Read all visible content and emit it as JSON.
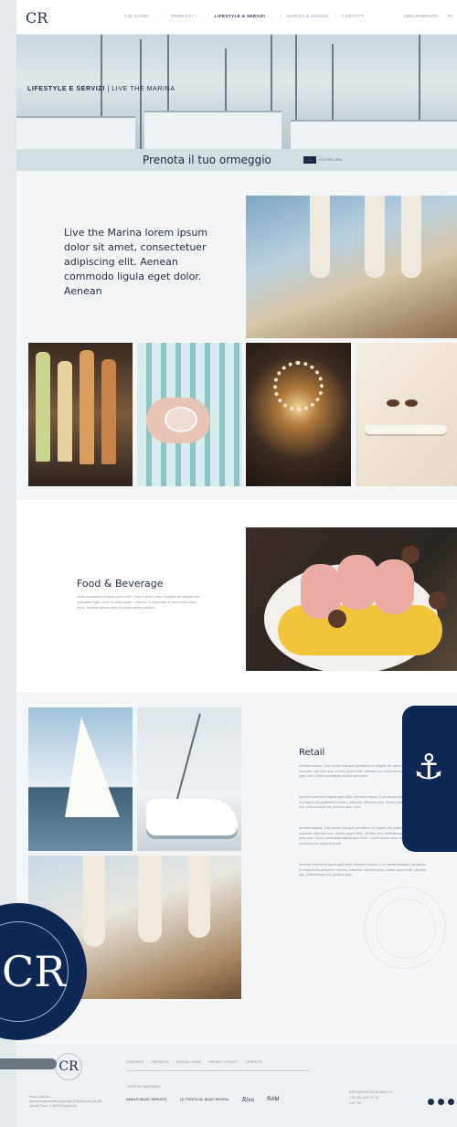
{
  "nav": {
    "logo": "CR",
    "menu": [
      {
        "label": "CHI SIAMO"
      },
      {
        "label": "ORMEGGI"
      },
      {
        "label": "LIFESTYLE & SERVIZI",
        "active": true
      },
      {
        "label": "MARINA & NEGOZI"
      },
      {
        "label": "CONTATTI"
      }
    ],
    "right": [
      "AREA RISERVATA",
      "ITA"
    ]
  },
  "hero": {
    "title_bold": "LIFESTYLE E SERVIZI",
    "title_rest": "| LIVE THE MARINA"
  },
  "booking": {
    "label": "Prenota il tuo ormeggio",
    "button_icon": "arrow-icon",
    "button_text": "SCOPRI ORA"
  },
  "section1": {
    "text": "Live the Marina lorem ipsum dolor sit amet, consectetuer adipiscing elit. Aenean commodo ligula eget dolor. Aenean"
  },
  "food": {
    "title": "Food & Beverage",
    "para": "Nulla consequat massa quis enim. Donec pede justo, fringilla vel aliquet nec, vulputate eget, arcu. In enim justo, rhoncus ut imperdiet a, venenatis vitae, justo. Nullam dictum felis eu pede mollis pretium."
  },
  "retail": {
    "title": "Retail",
    "paragraphs": [
      "Aenean massa. Cum sociis natoque penatibus et magnis dis parturient montes, nascetur ridiculus mus. Donec quam felis, ultricies nec, pellentesque eu, pretium quis, sem. Nulla consequat massa quis enim.",
      "Aenean commodo ligula eget dolor. Aenean massa. Cum sociis natoque penatibus et magnis dis parturient montes, nascetur ridiculus mus. Donec quam felis, ultricies nec, pellentesque eu, pretium quis, sem.",
      "Aenean massa. Cum sociis natoque penatibus et magnis dis parturient montes, nascetur ridiculus mus. Donec quam felis, ultricies nec, pellentesque eu, pretium quis, sem. Nulla consequat massa quis enim. Lorem ipsum dolor sit amet, consectetuer adipiscing elit.",
      "Aenean commodo ligula eget dolor. Aenean massa. Cum sociis natoque penatibus et magnis dis parturient montes, nascetur ridiculus mus. Donec quam felis, ultricies nec, pellentesque eu, pretium quis."
    ]
  },
  "badge": {
    "icon": "knot-icon"
  },
  "footer": {
    "logo": "CR",
    "menu": [
      "CONTATTI",
      "ORMEGGI",
      "SOCIAL LINKS",
      "PRIVACY POLICY",
      "CREDITS"
    ],
    "partners_label": "I NOSTRI PARTNERS",
    "partners": [
      "AMALFI BOAT SERVICE",
      "LE TROPICAL BOAT RENTAL",
      "Riva",
      "RAM"
    ],
    "address": "Porto Cala Blu\nMarina turistica internazionale di Marina di Cala Blu\nVia del Porto, 1, 80070 Napoli NA",
    "contact": "INFO@PORTOCALABLU.IT\n+39 081 234 56 78\nVHF 09",
    "social_icons": [
      "facebook-icon",
      "instagram-icon",
      "twitter-icon"
    ]
  },
  "seal": {
    "letters": "CR"
  },
  "colors": {
    "navy": "#0f2754",
    "booking_bg": "#cfdfe2",
    "text": "#1d2a44"
  }
}
